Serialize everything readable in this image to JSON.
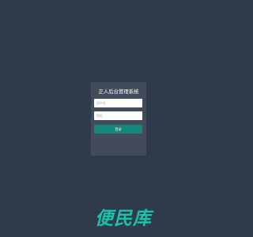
{
  "login": {
    "title": "正人后台管理系统",
    "username_placeholder": "用户名",
    "password_placeholder": "密码",
    "submit_label": "登录"
  },
  "watermark": {
    "text": "便民库"
  },
  "colors": {
    "page_background": "#2f3a4a",
    "card_background": "#414b59",
    "button": "#13877c",
    "watermark": "#19c3a9"
  }
}
